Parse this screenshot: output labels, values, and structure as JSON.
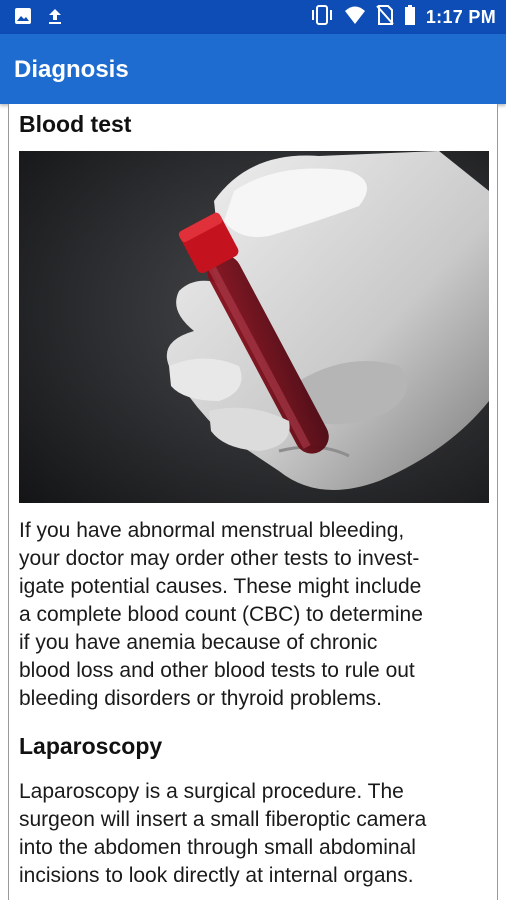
{
  "status_bar": {
    "time": "1:17 PM",
    "icons_left": [
      "image-icon",
      "upload-icon"
    ],
    "icons_right": [
      "vibrate-icon",
      "wifi-icon",
      "no-sim-icon",
      "battery-icon"
    ]
  },
  "app_bar": {
    "title": "Diagnosis",
    "background": "#1e6ccf",
    "status_background": "#0d4db5"
  },
  "sections": [
    {
      "heading": "Blood test",
      "image": "blood-test-photo",
      "paragraph_lines": [
        "If you have abnormal menstrual bleeding,",
        "your doctor may order other tests to invest-",
        "igate potential causes. These might include",
        "a complete blood count (CBC) to determine",
        "if you have anemia because of chronic",
        "blood loss and other blood tests to rule out",
        "bleeding disorders or thyroid problems."
      ]
    },
    {
      "heading": "Laparoscopy",
      "paragraph_lines": [
        "Laparoscopy is a surgical procedure. The",
        "surgeon will insert a small fiberoptic camera",
        "into the abdomen through small abdominal",
        "incisions to look directly at internal organs."
      ]
    }
  ]
}
